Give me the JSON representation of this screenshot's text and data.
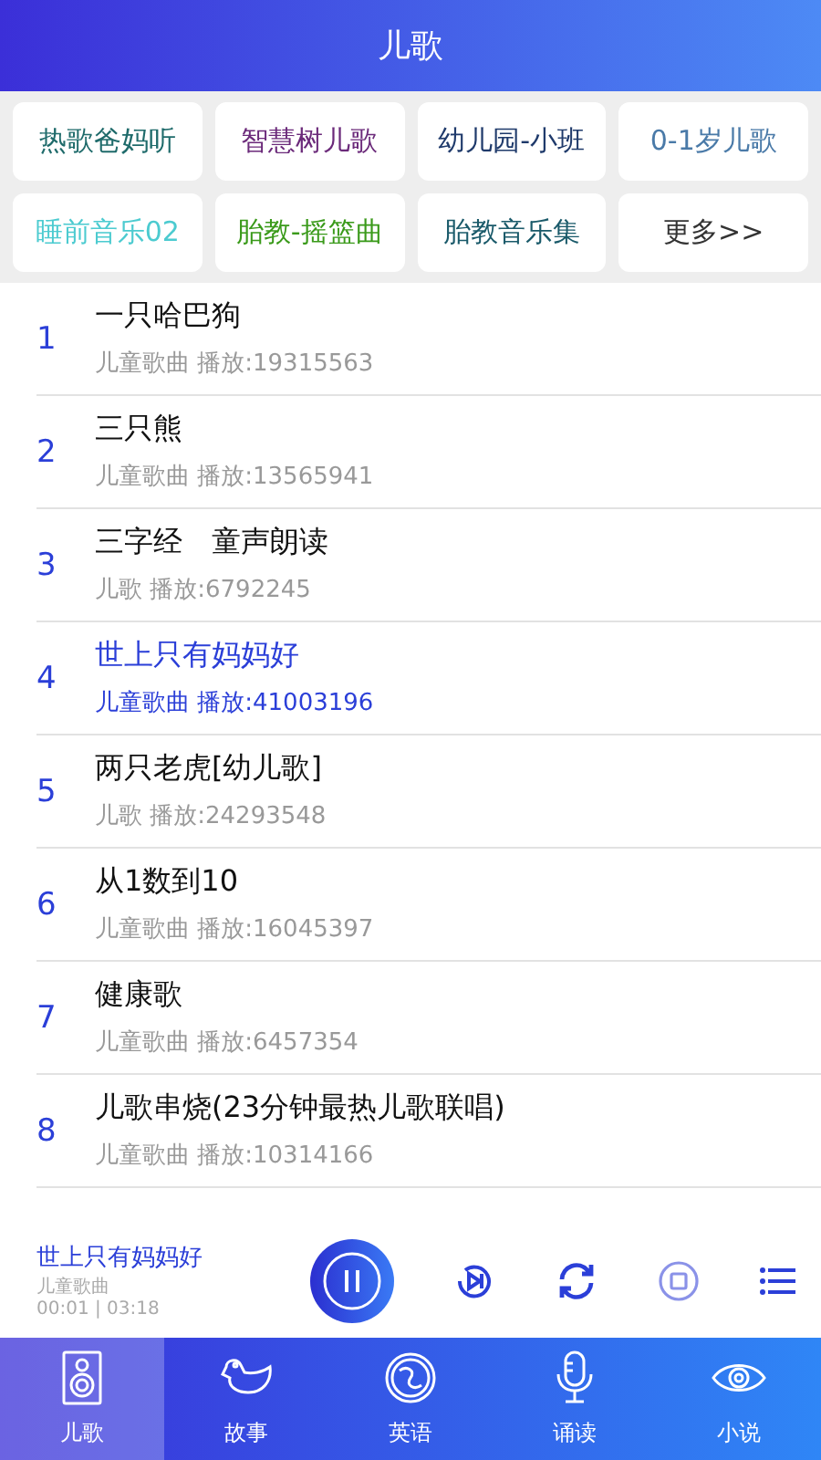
{
  "header": {
    "title": "儿歌"
  },
  "categories": [
    {
      "label": "热歌爸妈听",
      "color": "#1f6b6b"
    },
    {
      "label": "智慧树儿歌",
      "color": "#6b2a7a"
    },
    {
      "label": "幼儿园-小班",
      "color": "#1f3a6b"
    },
    {
      "label": "0-1岁儿歌",
      "color": "#4a7aa8"
    },
    {
      "label": "睡前音乐02",
      "color": "#4ccbd0"
    },
    {
      "label": "胎教-摇篮曲",
      "color": "#3a9a1a"
    },
    {
      "label": "胎教音乐集",
      "color": "#1a5a6a"
    },
    {
      "label": "更多>>",
      "color": "#333333"
    }
  ],
  "tracks": [
    {
      "index": "1",
      "title": "一只哈巴狗",
      "meta": "儿童歌曲 播放:19315563",
      "selected": false
    },
    {
      "index": "2",
      "title": "三只熊",
      "meta": "儿童歌曲 播放:13565941",
      "selected": false
    },
    {
      "index": "3",
      "title": "三字经　童声朗读",
      "meta": "儿歌 播放:6792245",
      "selected": false
    },
    {
      "index": "4",
      "title": "世上只有妈妈好",
      "meta": "儿童歌曲 播放:41003196",
      "selected": true
    },
    {
      "index": "5",
      "title": "两只老虎[幼儿歌]",
      "meta": "儿歌 播放:24293548",
      "selected": false
    },
    {
      "index": "6",
      "title": "从1数到10",
      "meta": "儿童歌曲 播放:16045397",
      "selected": false
    },
    {
      "index": "7",
      "title": "健康歌",
      "meta": "儿童歌曲 播放:6457354",
      "selected": false
    },
    {
      "index": "8",
      "title": "儿歌串烧(23分钟最热儿歌联唱)",
      "meta": "儿童歌曲 播放:10314166",
      "selected": false
    }
  ],
  "player": {
    "title": "世上只有妈妈好",
    "subtitle": "儿童歌曲",
    "time": "00:01 | 03:18"
  },
  "tabs": [
    {
      "label": "儿歌",
      "kind": "speaker",
      "selected": true
    },
    {
      "label": "故事",
      "kind": "duck",
      "selected": false
    },
    {
      "label": "英语",
      "kind": "globe",
      "selected": false
    },
    {
      "label": "诵读",
      "kind": "mic",
      "selected": false
    },
    {
      "label": "小说",
      "kind": "eye",
      "selected": false
    }
  ]
}
